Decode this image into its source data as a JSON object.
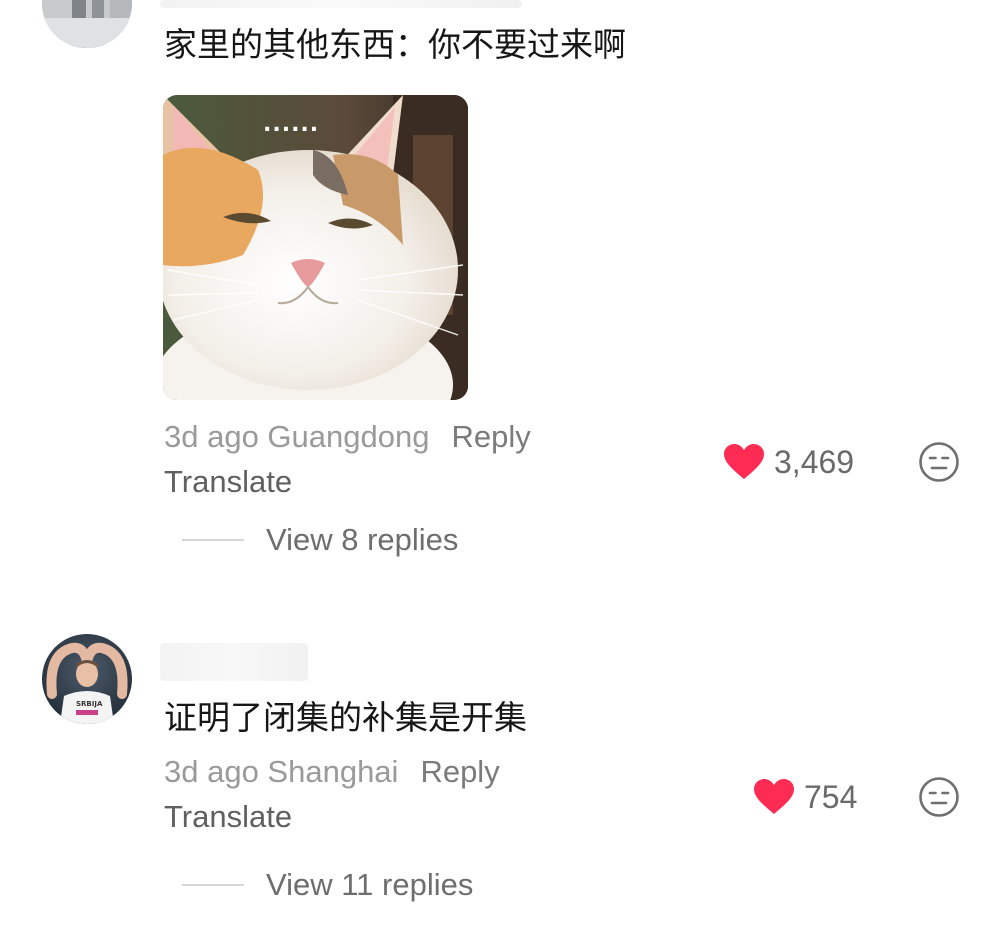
{
  "comments": [
    {
      "text": "家里的其他东西：你不要过来啊",
      "sticker": {
        "caption": "......"
      },
      "time_location": "3d ago Guangdong",
      "reply_label": "Reply",
      "translate_label": "Translate",
      "likes": "3,469",
      "view_replies": "View 8 replies"
    },
    {
      "text": "证明了闭集的补集是开集",
      "avatar_jersey": "SRBIJA",
      "time_location": "3d ago Shanghai",
      "reply_label": "Reply",
      "translate_label": "Translate",
      "likes": "754",
      "view_replies": "View 11 replies"
    }
  ],
  "colors": {
    "heart": "#fe2c55",
    "meta_gray": "#9a9a9a",
    "text": "#161616"
  },
  "icons": {
    "like": "heart-icon",
    "dislike": "neutral-face-icon"
  }
}
